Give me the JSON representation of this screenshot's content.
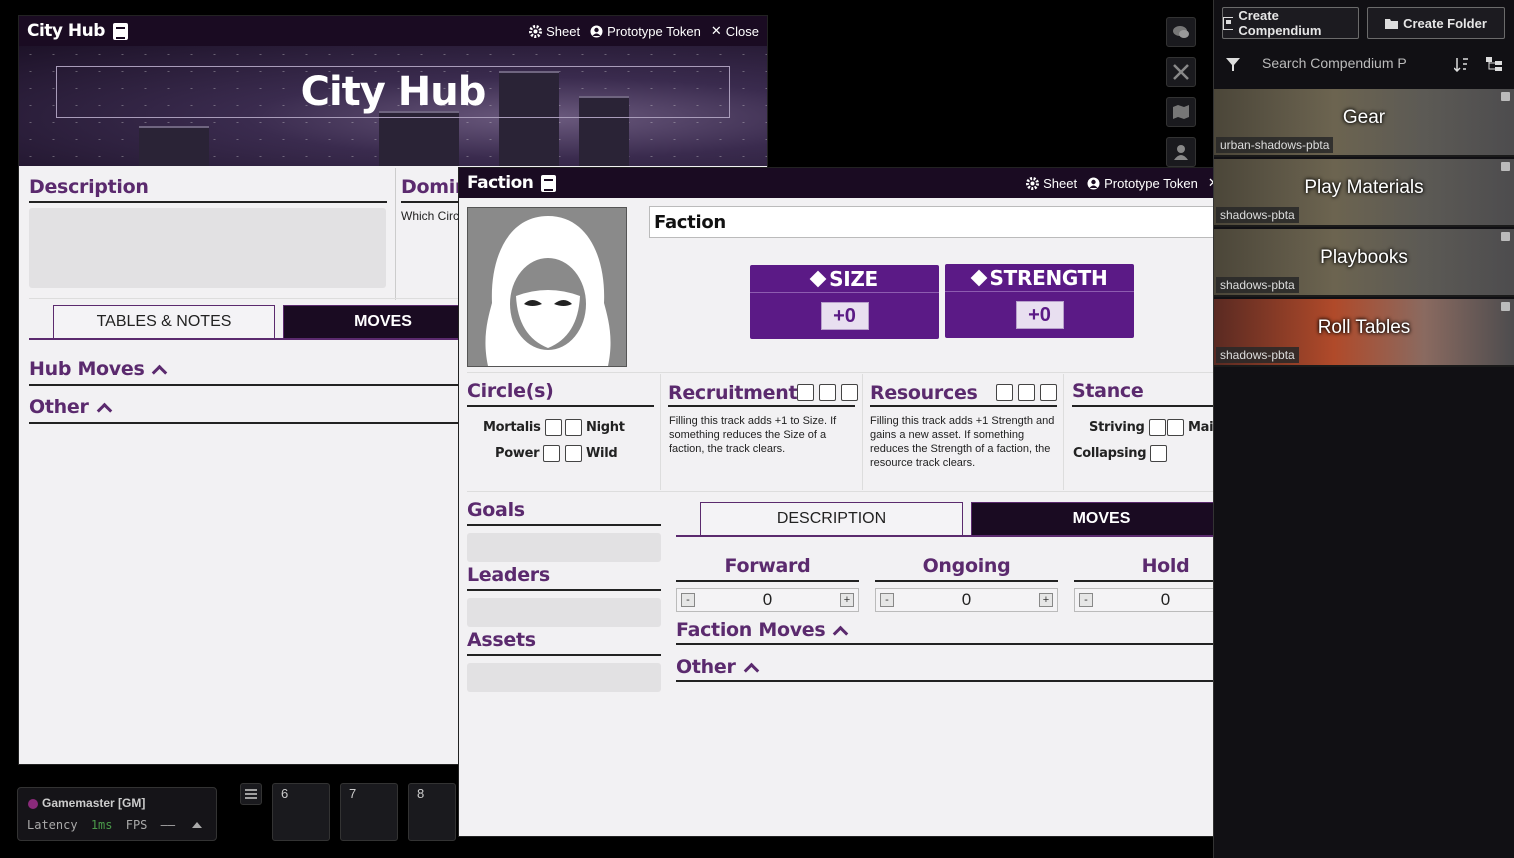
{
  "window_controls": {
    "sheet": "Sheet",
    "prototype_token": "Prototype Token",
    "close": "Close"
  },
  "city_hub": {
    "window_title": "City Hub",
    "name": "City Hub",
    "description_heading": "Description",
    "dominion_heading": "Domina",
    "dominion_sub": "Which Circ",
    "tabs": [
      "TABLES & NOTES",
      "MOVES"
    ],
    "sections": [
      "Hub Moves",
      "Other"
    ]
  },
  "faction": {
    "window_title": "Faction",
    "name": "Faction",
    "stats": [
      {
        "label": "SIZE",
        "value": "+0"
      },
      {
        "label": "STRENGTH",
        "value": "+0"
      }
    ],
    "circles_heading": "Circle(s)",
    "circles": [
      "Mortalis",
      "Night",
      "Power",
      "Wild"
    ],
    "recruitment_heading": "Recruitment",
    "recruitment_text": "Filling this track adds +1 to Size. If something reduces the Size of a faction, the track clears.",
    "resources_heading": "Resources",
    "resources_text": "Filling this track adds +1 Strength and gains a new asset. If something reduces the Strength of a faction, the resource track clears.",
    "stance_heading": "Stance",
    "stances": [
      "Striving",
      "Maintaining",
      "Collapsing"
    ],
    "goals_heading": "Goals",
    "leaders_heading": "Leaders",
    "assets_heading": "Assets",
    "tabs": [
      "DESCRIPTION",
      "MOVES"
    ],
    "counters": [
      {
        "label": "Forward",
        "value": "0"
      },
      {
        "label": "Ongoing",
        "value": "0"
      },
      {
        "label": "Hold",
        "value": "0"
      }
    ],
    "counter_minus": "-",
    "counter_plus": "+",
    "sections": [
      "Faction Moves",
      "Other"
    ]
  },
  "sidebar": {
    "create_compendium": "Create Compendium",
    "create_folder": "Create Folder",
    "search_placeholder": "Search Compendium P",
    "packs": [
      {
        "name": "Gear",
        "source": "urban-shadows-pbta"
      },
      {
        "name": "Play Materials",
        "source": "shadows-pbta"
      },
      {
        "name": "Playbooks",
        "source": "shadows-pbta"
      },
      {
        "name": "Roll Tables",
        "source": "shadows-pbta"
      }
    ]
  },
  "players": {
    "gm": "Gamemaster [GM]",
    "latency_label": "Latency",
    "latency_value": "1ms",
    "fps_label": "FPS",
    "fps_value": "——"
  },
  "hotbar": [
    "6",
    "7",
    "8"
  ],
  "colors": {
    "accent": "#5b1a86",
    "heading": "#5b2a6e",
    "titlebar": "#1a0b22"
  }
}
